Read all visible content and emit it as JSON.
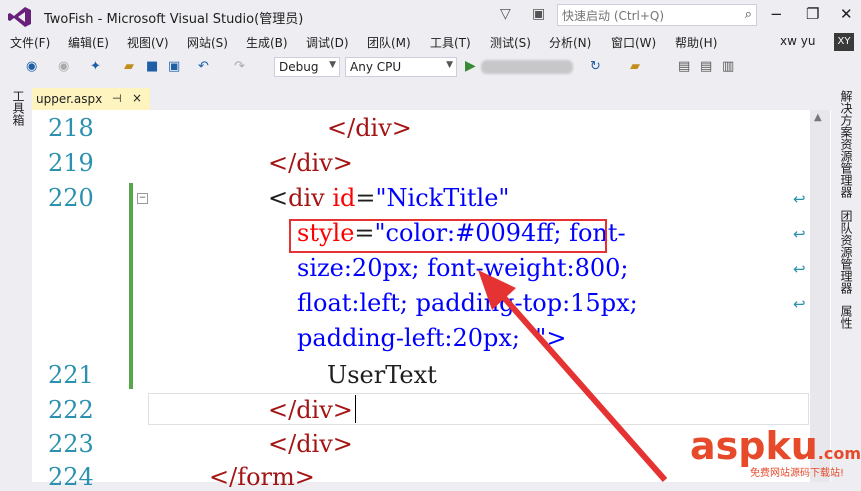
{
  "window": {
    "title": "TwoFish - Microsoft Visual Studio(管理员)",
    "quick_launch_placeholder": "快速启动 (Ctrl+Q)",
    "buttons": {
      "minimize": "−",
      "restore": "❐",
      "close": "✕"
    }
  },
  "menu": {
    "items": [
      "文件(F)",
      "编辑(E)",
      "视图(V)",
      "网站(S)",
      "生成(B)",
      "调试(D)",
      "团队(M)",
      "工具(T)",
      "测试(S)",
      "分析(N)",
      "窗口(W)",
      "帮助(H)"
    ],
    "user": "xw yu",
    "avatar": "XY"
  },
  "toolbar": {
    "config": "Debug",
    "platform": "Any CPU"
  },
  "left_rail": {
    "label": "工具箱"
  },
  "right_rail": {
    "labels": [
      "解决方案资源管理器",
      "团队资源管理器",
      "属性"
    ]
  },
  "tab": {
    "name": "upper.aspx",
    "pin": "⊣",
    "close": "×"
  },
  "editor": {
    "line_numbers": [
      "218",
      "219",
      "220",
      "221",
      "222",
      "223",
      "224"
    ],
    "lines": {
      "l218": "</div>",
      "l219": "</div>",
      "l220_open": "<",
      "l220_tag": "div",
      "l220_attr": "id",
      "l220_eq": "=",
      "l220_val": "\"NickTitle\"",
      "w1_attr": "style",
      "w1_eq": "=",
      "w1_val": "\"color:#0094ff; font-",
      "w2_val": "size:20px; font-weight:800;",
      "w3_val": "float:left; padding-top:15px;",
      "w4_val": "padding-left:20px;  \">",
      "l221": "UserText",
      "l222": "</div>",
      "l223": "</div>",
      "l224": "</form>"
    }
  },
  "watermark": {
    "main": "aspku",
    "dot_com": ".com",
    "sub": "免费网站源码下载站!"
  }
}
